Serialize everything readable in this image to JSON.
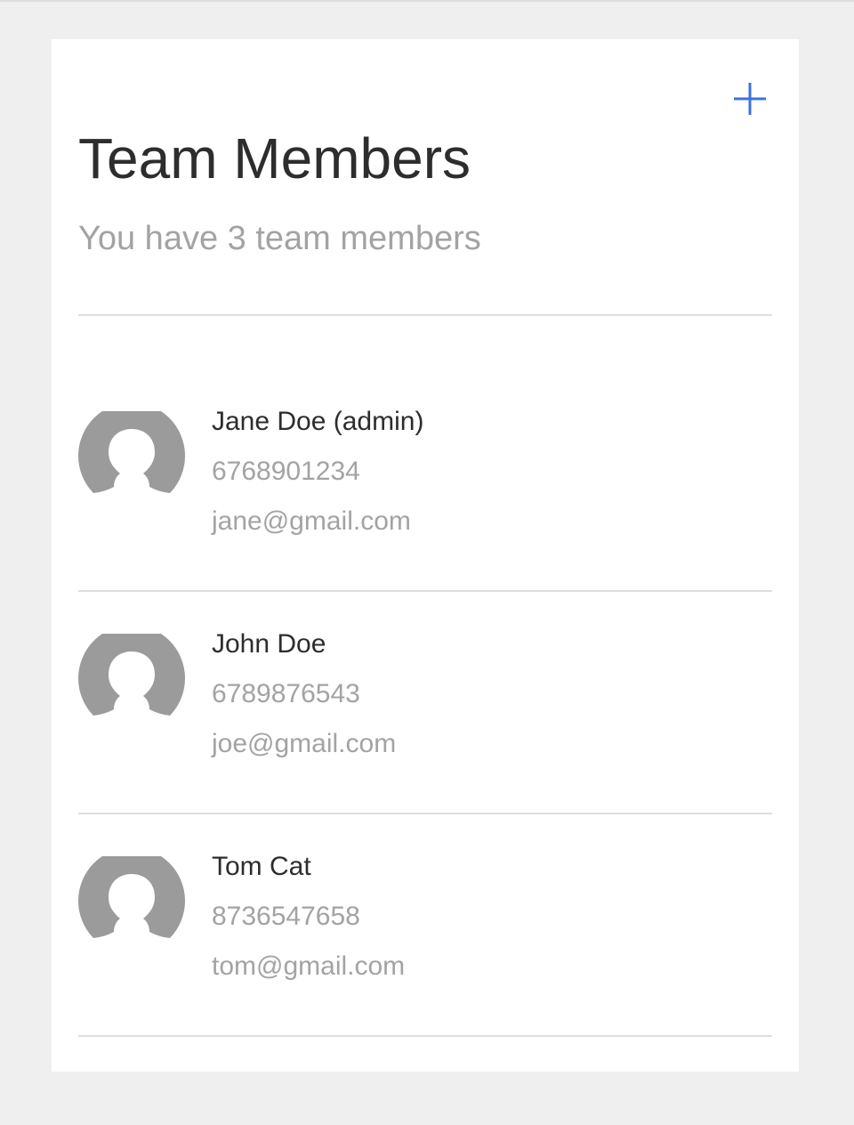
{
  "header": {
    "title": "Team Members",
    "subtitle": "You have 3 team members",
    "add_icon": "plus-icon"
  },
  "colors": {
    "accent": "#3b73e0",
    "avatar": "#9b9b9b",
    "divider": "#dedede",
    "primary_text": "#2d2d2d",
    "secondary_text": "#a3a3a3",
    "background": "#efefef",
    "card": "#ffffff"
  },
  "members": [
    {
      "name": "Jane Doe (admin)",
      "phone": "6768901234",
      "email": "jane@gmail.com",
      "avatar_icon": "user-avatar-icon"
    },
    {
      "name": "John Doe",
      "phone": "6789876543",
      "email": "joe@gmail.com",
      "avatar_icon": "user-avatar-icon"
    },
    {
      "name": "Tom Cat",
      "phone": "8736547658",
      "email": "tom@gmail.com",
      "avatar_icon": "user-avatar-icon"
    }
  ]
}
